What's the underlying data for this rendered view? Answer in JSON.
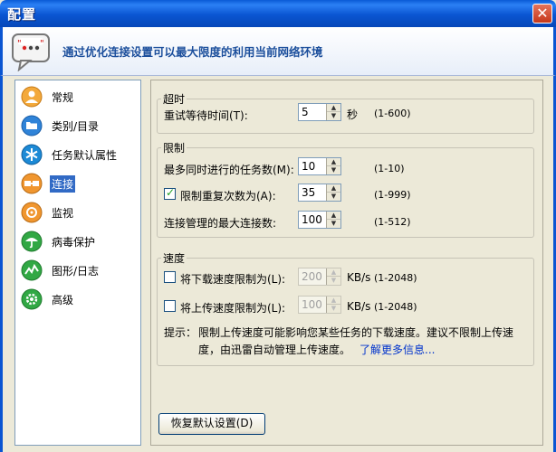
{
  "window": {
    "title": "配置"
  },
  "banner": {
    "text": "通过优化连接设置可以最大限度的利用当前网络环境"
  },
  "sidebar": {
    "items": [
      {
        "label": "常规",
        "icon": "general-icon",
        "color": "#f3a93b",
        "selected": false
      },
      {
        "label": "类别/目录",
        "icon": "folder-icon",
        "color": "#2f83d8",
        "selected": false
      },
      {
        "label": "任务默认属性",
        "icon": "snowflake-icon",
        "color": "#1c8ad6",
        "selected": false
      },
      {
        "label": "连接",
        "icon": "connection-icon",
        "color": "#f0962f",
        "selected": true
      },
      {
        "label": "监视",
        "icon": "monitor-icon",
        "color": "#f0962f",
        "selected": false
      },
      {
        "label": "病毒保护",
        "icon": "umbrella-icon",
        "color": "#31a844",
        "selected": false
      },
      {
        "label": "图形/日志",
        "icon": "graph-icon",
        "color": "#31a844",
        "selected": false
      },
      {
        "label": "高级",
        "icon": "advanced-icon",
        "color": "#31a844",
        "selected": false
      }
    ]
  },
  "timeout": {
    "legend": "超时",
    "retry_label": "重试等待时间(T):",
    "retry_value": "5",
    "unit": "秒",
    "range": "(1-600)"
  },
  "limits": {
    "legend": "限制",
    "max_tasks_label": "最多同时进行的任务数(M):",
    "max_tasks_value": "10",
    "max_tasks_range": "(1-10)",
    "retry_limit_label": "限制重复次数为(A):",
    "retry_limit_value": "35",
    "retry_limit_range": "(1-999)",
    "retry_limit_checked": true,
    "max_conn_label": "连接管理的最大连接数:",
    "max_conn_value": "100",
    "max_conn_range": "(1-512)"
  },
  "speed": {
    "legend": "速度",
    "download_label": "将下载速度限制为(L):",
    "download_value": "200",
    "download_unit": "KB/s",
    "download_range": "(1-2048)",
    "upload_label": "将上传速度限制为(L):",
    "upload_value": "100",
    "upload_unit": "KB/s",
    "upload_range": "(1-2048)",
    "hint_prefix": "提示：",
    "hint_line1": "限制上传速度可能影响您某些任务的下载速度。建议不限制上传速",
    "hint_line2": "度，由迅雷自动管理上传速度。",
    "more_info_link": "了解更多信息..."
  },
  "restore_defaults_label": "恢复默认设置(D)"
}
